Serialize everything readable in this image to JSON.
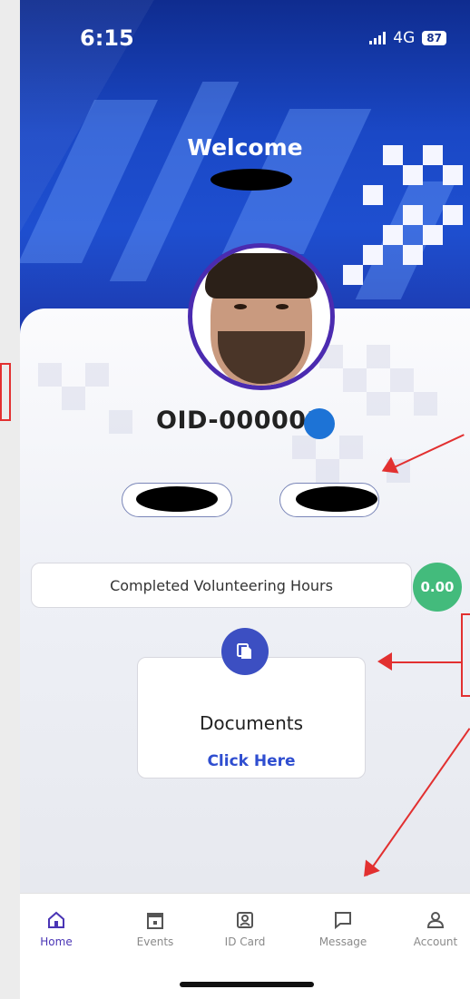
{
  "status_bar": {
    "time": "6:15",
    "network": "4G",
    "battery": "87"
  },
  "header": {
    "welcome": "Welcome"
  },
  "profile": {
    "oid": "OID-000001"
  },
  "hours": {
    "label": "Completed  Volunteering Hours",
    "value": "0.00"
  },
  "documents": {
    "title": "Documents",
    "link": "Click Here"
  },
  "nav": {
    "items": [
      {
        "label": "Home",
        "icon": "home-icon",
        "active": true
      },
      {
        "label": "Events",
        "icon": "calendar-icon"
      },
      {
        "label": "ID Card",
        "icon": "id-card-icon"
      },
      {
        "label": "Message",
        "icon": "message-icon"
      },
      {
        "label": "Account",
        "icon": "account-icon"
      }
    ]
  },
  "colors": {
    "primary": "#2f4ed0",
    "accent_purple": "#4b2bb0",
    "success": "#43bb7c",
    "annotation": "#e23030"
  }
}
